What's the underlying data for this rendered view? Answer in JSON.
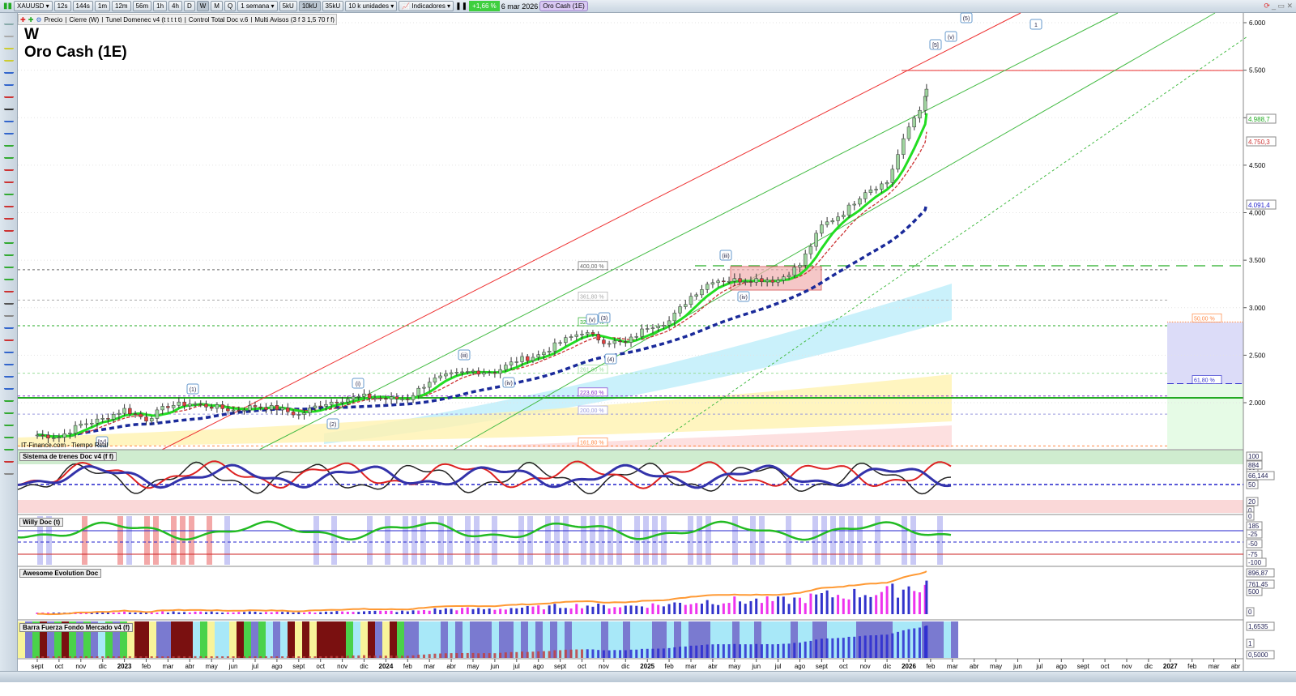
{
  "toolbar": {
    "symbol": "XAUUSD",
    "timeframes": [
      "12s",
      "144s",
      "1m",
      "12m",
      "56m",
      "1h",
      "4h",
      "D",
      "W",
      "M",
      "Q"
    ],
    "active_timeframe": "W",
    "period": "1 semana",
    "units_buttons": [
      "5kU",
      "10kU",
      "35kU"
    ],
    "active_unit": "10kU",
    "units_select": "10 k unidades",
    "indicators_label": "Indicadores",
    "change": "+1,66 %",
    "date": "6 mar 2026",
    "instrument_tag": "Oro Cash (1E)"
  },
  "legend": [
    "Precio",
    "Cierre (W)",
    "Tunel Domenec v4 (t t t t t)",
    "Control Total Doc v.6",
    "Multi Avisos (3 f 3 1,5 70 f f)"
  ],
  "chart_title": {
    "tf": "W",
    "name": "Oro Cash (1E)"
  },
  "watermark": "IT-Finance.com - Tiempo Real",
  "panes": [
    "Sistema de trenes Doc v4 (f f)",
    "Willy Doc (t)",
    "Awesome Evolution Doc",
    "Barra Fuerza Fondo Mercado v4 (f)"
  ],
  "colors": {
    "up": "#3cc83c",
    "red": "#e83030",
    "blue": "#1a2a9a",
    "green": "#22bb22"
  },
  "chart_data": {
    "type": "candlestick",
    "x_months": [
      "sept",
      "oct",
      "nov",
      "dic",
      "2023",
      "feb",
      "mar",
      "abr",
      "may",
      "jun",
      "jul",
      "ago",
      "sept",
      "oct",
      "nov",
      "dic",
      "2024",
      "feb",
      "mar",
      "abr",
      "may",
      "jun",
      "jul",
      "ago",
      "sept",
      "oct",
      "nov",
      "dic",
      "2025",
      "feb",
      "mar",
      "abr",
      "may",
      "jun",
      "jul",
      "ago",
      "sept",
      "oct",
      "nov",
      "dic",
      "2026",
      "feb",
      "mar",
      "abr",
      "may",
      "jun",
      "jul",
      "ago",
      "sept",
      "oct",
      "nov",
      "dic",
      "2027",
      "feb",
      "mar",
      "abr"
    ],
    "monthly_close": [
      1660,
      1640,
      1770,
      1825,
      1930,
      1825,
      1970,
      1990,
      1960,
      1920,
      1965,
      1940,
      1870,
      1985,
      2035,
      2065,
      2040,
      2045,
      2230,
      2290,
      2330,
      2325,
      2445,
      2500,
      2635,
      2745,
      2650,
      2625,
      2800,
      2860,
      3120,
      3290,
      3290,
      3300,
      3290,
      3450,
      3860,
      4000,
      4230,
      4320,
      4900,
      5300
    ],
    "y_ticks": [
      2000,
      2500,
      3000,
      3500,
      4000,
      4500,
      5000,
      5500,
      6000
    ],
    "y_tick_labels": [
      "2.000",
      "2.500",
      "3.000",
      "3.500",
      "4.000",
      "4.500",
      "5.000",
      "5.500",
      "6.000"
    ],
    "price_labels": [
      "4.988,7",
      "4.750,3",
      "4.091,4"
    ],
    "fib_labels": [
      "400,00 %",
      "361,80 %",
      "323,60 %",
      "261,80 %",
      "223,60 %",
      "200,00 %",
      "161,80 %",
      "50,00 %",
      "61,80 %"
    ],
    "fib_levels": [
      3400,
      3080,
      2810,
      2310,
      2070,
      1880,
      1545,
      2850,
      2200
    ],
    "wave_labels": [
      "(1)",
      "(2)",
      "(i)",
      "(iii)",
      "(iv)",
      "(v)",
      "(3)",
      "(4)",
      "(iii)",
      "(iv)",
      "[5]",
      "(v)",
      "(5)",
      "1",
      "[IV]"
    ],
    "osc1_ticks": [
      "100",
      "80",
      "884",
      "66,144",
      "50",
      "20",
      "0"
    ],
    "osc2_ticks": [
      "0",
      "-25",
      "-50",
      "-75",
      "-100",
      "185"
    ],
    "osc3_ticks": [
      "896,87",
      "761,45",
      "500",
      "0"
    ],
    "osc4_ticks": [
      "1,6535",
      "1",
      "0,5000"
    ]
  }
}
